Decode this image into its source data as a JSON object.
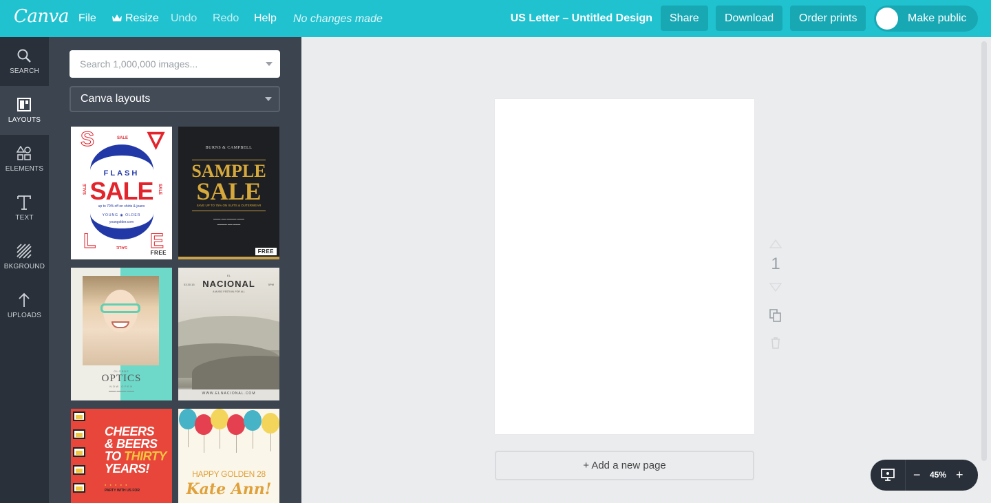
{
  "app": {
    "logo_text": "Canva",
    "accent_color": "#20c2d0"
  },
  "topbar": {
    "menu": {
      "file": "File",
      "resize": "Resize",
      "undo": "Undo",
      "redo": "Redo",
      "help": "Help"
    },
    "status": "No changes made",
    "doc_title": "US Letter – Untitled Design",
    "share": "Share",
    "download": "Download",
    "order_prints": "Order prints",
    "make_public": "Make public"
  },
  "rail": {
    "items": [
      {
        "label": "SEARCH",
        "icon": "search-icon"
      },
      {
        "label": "LAYOUTS",
        "icon": "layouts-icon",
        "active": true
      },
      {
        "label": "ELEMENTS",
        "icon": "elements-icon"
      },
      {
        "label": "TEXT",
        "icon": "text-icon"
      },
      {
        "label": "BKGROUND",
        "icon": "background-icon"
      },
      {
        "label": "UPLOADS",
        "icon": "upload-icon"
      }
    ]
  },
  "panel": {
    "search_placeholder": "Search 1,000,000 images...",
    "layout_select": "Canva layouts",
    "free_badge": "FREE",
    "templates": {
      "flash_sale": {
        "top_small": "SALE",
        "flash": "FLASH",
        "sale": "SALE",
        "side_left": "SALE",
        "side_right": "SALE",
        "sub": "up to 70% off on shirts & jeans",
        "brand": "YOUNG ◉ OLDER",
        "url": "youngolder.com",
        "bottom_small": "SALE",
        "free": true
      },
      "sample_sale": {
        "brand": "BURNS & CAMPBELL",
        "line1": "SAMPLE",
        "line2": "SALE",
        "sub": "SAVE UP TO 75% ON SUITS & OUTERWEAR",
        "free": true
      },
      "optics": {
        "top": "GLOBBE",
        "title": "OPTICS",
        "now": "NOW OPEN"
      },
      "nacional": {
        "el": "EL",
        "name": "NACIONAL",
        "date": "03.30.15",
        "time": "5PM",
        "tag": "A MUSIC FESTIVAL FOR ALL",
        "url": "WWW.ELNACIONAL.COM"
      },
      "cheers": {
        "l1": "CHEERS",
        "l2": "& BEERS",
        "l3a": "TO ",
        "l3b": "THIRTY",
        "l4": "YEARS!",
        "party": "PARTY WITH US FOR"
      },
      "golden": {
        "title": "HAPPY GOLDEN 28",
        "script": "Kate Ann!"
      }
    }
  },
  "canvas": {
    "add_page": "+ Add a new page",
    "page_number": "1",
    "zoom": "45%"
  }
}
